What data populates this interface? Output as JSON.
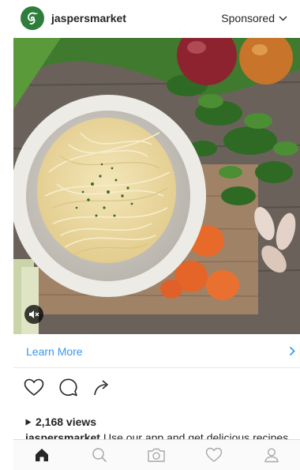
{
  "post": {
    "username": "jaspersmarket",
    "sponsored_label": "Sponsored",
    "cta_label": "Learn More",
    "views": "2,168 views",
    "caption_user": "jaspersmarket",
    "caption_text": "Use our app and get delicious recipes"
  },
  "colors": {
    "link": "#3897f0",
    "brand": "#2f7d3a"
  },
  "icons": {
    "avatar": "jaspersmarket-logo",
    "sponsored": "chevron-down-icon",
    "mute": "speaker-muted-icon",
    "cta": "chevron-right-icon",
    "actions": [
      "heart-icon",
      "comment-icon",
      "share-icon"
    ],
    "nav": [
      "home-icon",
      "search-icon",
      "camera-icon",
      "activity-heart-icon",
      "profile-icon"
    ]
  }
}
